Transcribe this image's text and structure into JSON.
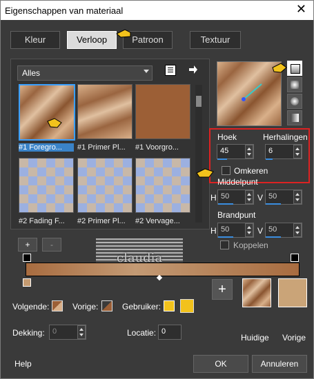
{
  "window": {
    "title": "Eigenschappen van materiaal",
    "close": "✕"
  },
  "tabs": [
    {
      "label": "Kleur"
    },
    {
      "label": "Verloop"
    },
    {
      "label": "Patroon"
    },
    {
      "label": "Textuur"
    }
  ],
  "library": {
    "dropdown_value": "Alles",
    "items": [
      {
        "label": "#1 Foregro..."
      },
      {
        "label": "#1 Primer Pl..."
      },
      {
        "label": "#1 Voorgro..."
      },
      {
        "label": "#2 Fading F..."
      },
      {
        "label": "#2 Primer Pl..."
      },
      {
        "label": "#2 Vervage..."
      }
    ]
  },
  "settings": {
    "hoek_label": "Hoek",
    "hoek_value": "45",
    "herhalingen_label": "Herhalingen",
    "herhalingen_value": "6",
    "omkeren_label": "Omkeren",
    "middelpunt_label": "Middelpunt",
    "brandpunt_label": "Brandpunt",
    "h_label": "H",
    "v_label": "V",
    "mid_h": "50",
    "mid_v": "50",
    "brand_h": "50",
    "brand_v": "50",
    "koppelen_label": "Koppelen"
  },
  "editor": {
    "add": "+",
    "remove": "-",
    "volgende_label": "Volgende:",
    "vorige_label": "Vorige:",
    "gebruiker_label": "Gebruiker:",
    "dekking_label": "Dekking:",
    "dekking_value": "0",
    "locatie_label": "Locatie:",
    "locatie_value": "0",
    "user_color": "#f2c21c"
  },
  "preview": {
    "add": "+",
    "huidige_label": "Huidige",
    "vorige_label": "Vorige"
  },
  "footer": {
    "help": "Help",
    "ok": "OK",
    "cancel": "Annuleren"
  },
  "watermark": {
    "text": "claudia"
  }
}
